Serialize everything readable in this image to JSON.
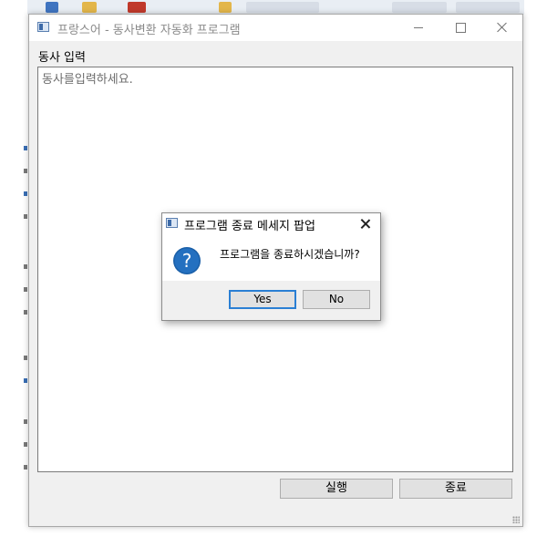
{
  "window": {
    "title": "프랑스어 - 동사변환 자동화 프로그램"
  },
  "main": {
    "verb_label": "동사 입력",
    "input_placeholder": "동사를입력하세요.",
    "run_button": "실행",
    "quit_button": "종료"
  },
  "dialog": {
    "title": "프로그램 종료 메세지 팝업",
    "message": "프로그램을 종료하시겠습니까?",
    "yes_button": "Yes",
    "no_button": "No",
    "icon": "question-icon"
  },
  "colors": {
    "accent": "#2a7fd4",
    "question_icon": "#1a5fa8"
  }
}
